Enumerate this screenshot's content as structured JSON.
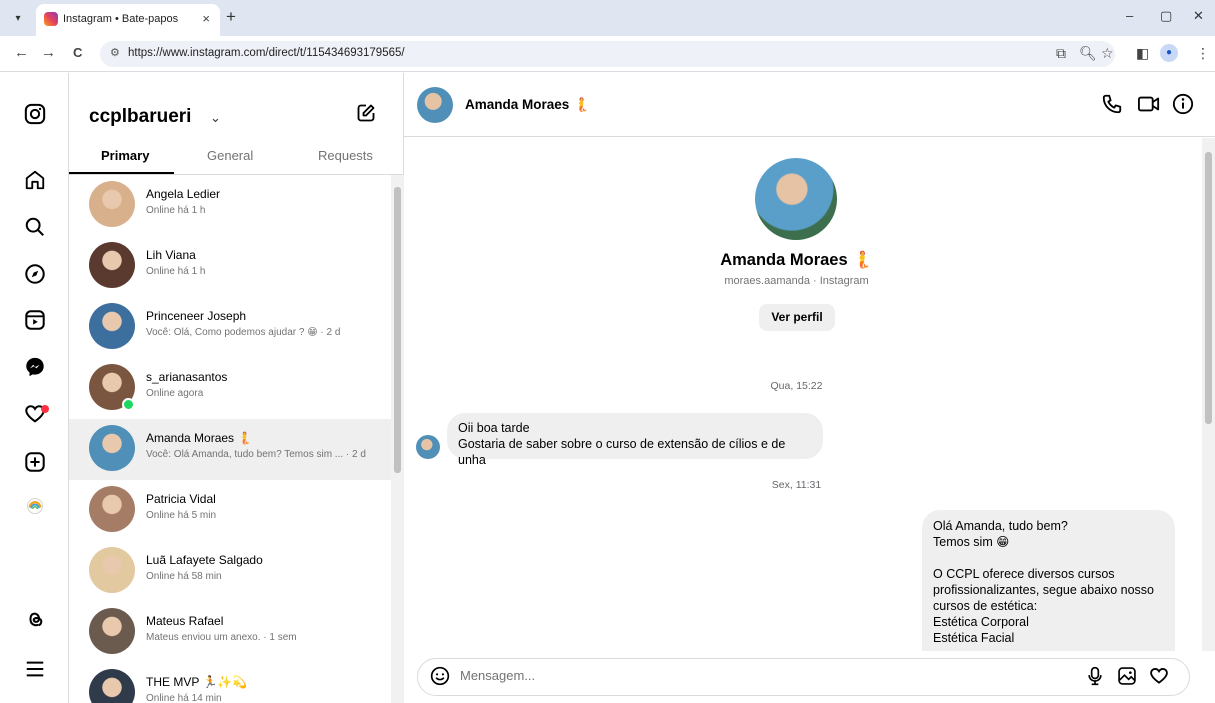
{
  "browser": {
    "tab_title": "Instagram • Bate-papos",
    "tab_close": "×",
    "new_tab": "+",
    "url": "https://www.instagram.com/direct/t/115434693179565/",
    "nav_back": "←",
    "nav_forward": "→",
    "nav_reload": "C",
    "win_min": "–",
    "win_max": "▢",
    "win_close": "✕"
  },
  "rail": {
    "icons": [
      "instagram-icon",
      "home-icon",
      "search-icon",
      "explore-icon",
      "reels-icon",
      "messenger-icon",
      "notifications-icon",
      "create-icon",
      "profile-icon",
      "threads-icon",
      "menu-icon"
    ]
  },
  "inbox": {
    "account": "ccplbarueri",
    "tabs": [
      "Primary",
      "General",
      "Requests"
    ],
    "threads": [
      {
        "name": "Angela Ledier",
        "sub": "Online há 1 h",
        "color": "#d9b08c"
      },
      {
        "name": "Lih Viana",
        "sub": "Online há 1 h",
        "color": "#5a3a2e"
      },
      {
        "name": "Princeneer Joseph",
        "sub": "Você: Olá, Como podemos ajudar ? 😁 · 2 d",
        "color": "#3d6f9e"
      },
      {
        "name": "s_arianasantos",
        "sub": "Online agora",
        "color": "#7a5540"
      },
      {
        "name": "Amanda Moraes 🧜",
        "sub": "Você: Olá Amanda, tudo bem? Temos sim ...  · 2 d",
        "color": "#4f8fb8"
      },
      {
        "name": "Patricia Vidal",
        "sub": "Online há 5 min",
        "color": "#a57c65"
      },
      {
        "name": "Luã Lafayete Salgado",
        "sub": "Online há 58 min",
        "color": "#e2c9a0"
      },
      {
        "name": "Mateus Rafael",
        "sub": "Mateus enviou um anexo. · 1 sem",
        "color": "#6b5a4e"
      },
      {
        "name": "THE MVP 🏃✨💫",
        "sub": "Online há 14 min",
        "color": "#2f3a4a"
      }
    ]
  },
  "chat": {
    "name": "Amanda Moraes 🧜",
    "profile_name": "Amanda Moraes 🧜",
    "handle": "moraes.aamanda · Instagram",
    "view_profile": "Ver perfil",
    "ts1": "Qua, 15:22",
    "in_line1": "Oii boa tarde",
    "in_line2": "Gostaria de saber sobre o curso de extensão de cílios e de unha",
    "ts2": "Sex, 11:31",
    "out_lines": [
      "Olá Amanda, tudo bem?",
      "Temos sim 😁",
      "",
      "O CCPL oferece diversos cursos profissionalizantes, segue abaixo nosso cursos de estética:",
      "Estética Corporal",
      "Estética Facial"
    ],
    "placeholder": "Mensagem..."
  }
}
